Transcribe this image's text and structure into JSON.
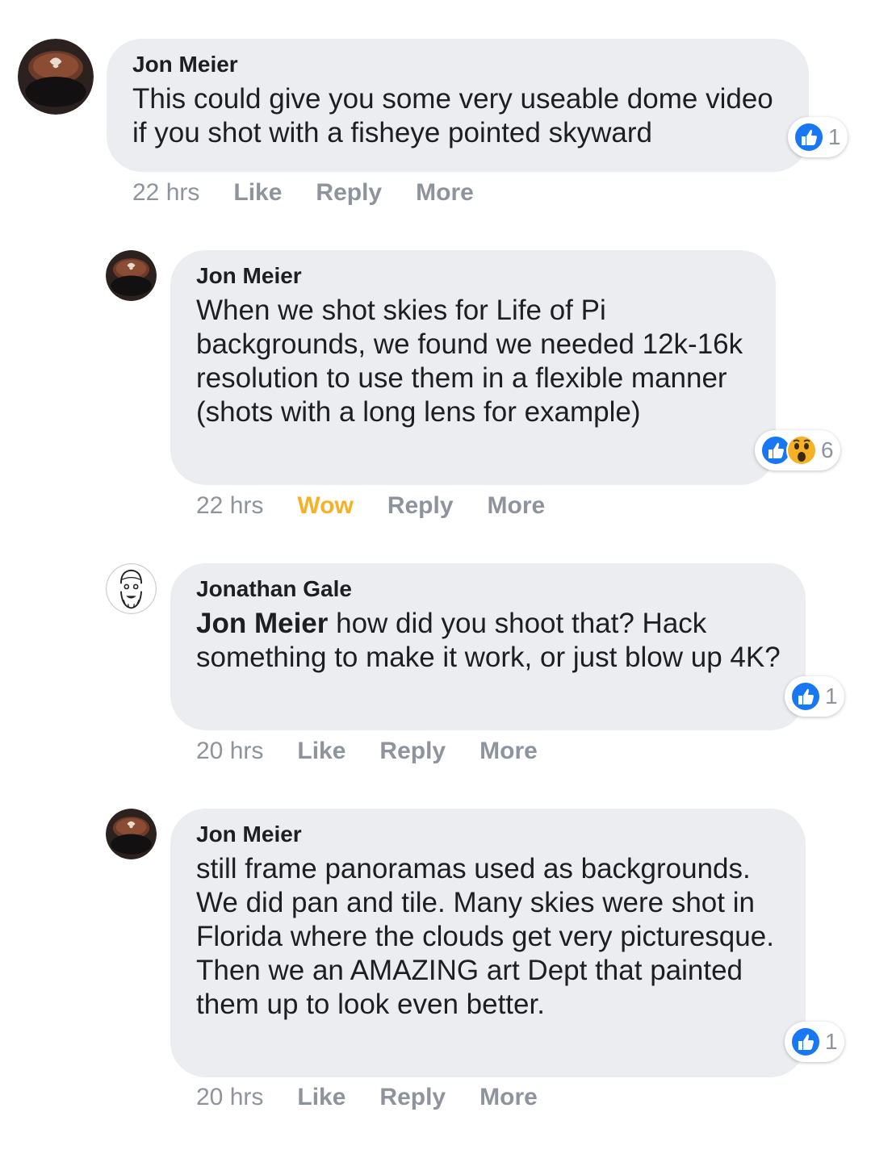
{
  "comments": [
    {
      "author": "Jon Meier",
      "text": "This could give you some very useable dome video if you shot with a fisheye pointed skyward",
      "reaction_count": "1",
      "time": "22 hrs",
      "actions": {
        "react": "Like",
        "reply": "Reply",
        "more": "More"
      },
      "reactions": [
        "like-icon"
      ]
    },
    {
      "author": "Jon Meier",
      "text": "When we shot skies for Life of Pi backgrounds, we found we needed 12k-16k resolution to use them in a flexible manner (shots with a long lens for example)",
      "reaction_count": "6",
      "time": "22 hrs",
      "actions": {
        "react": "Wow",
        "reply": "Reply",
        "more": "More"
      },
      "reactions": [
        "like-icon",
        "wow-icon"
      ]
    },
    {
      "author": "Jonathan Gale",
      "mention": "Jon Meier",
      "text": " how did you shoot that? Hack something to make it work, or just blow up 4K?",
      "reaction_count": "1",
      "time": "20 hrs",
      "actions": {
        "react": "Like",
        "reply": "Reply",
        "more": "More"
      },
      "reactions": [
        "like-icon"
      ]
    },
    {
      "author": "Jon Meier",
      "text": "still frame panoramas used as backgrounds. We did pan and tile. Many skies were shot in Florida where the clouds get very picturesque. Then we an AMAZING art Dept that painted them up to look even better.",
      "reaction_count": "1",
      "time": "20 hrs",
      "actions": {
        "react": "Like",
        "reply": "Reply",
        "more": "More"
      },
      "reactions": [
        "like-icon"
      ]
    }
  ],
  "colors": {
    "bubble": "#ebedf0",
    "meta_text": "#8d949e",
    "wow_active": "#f7b125",
    "like_blue": "#1877f2"
  }
}
